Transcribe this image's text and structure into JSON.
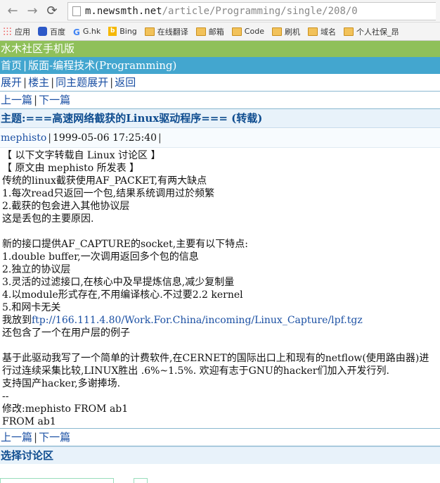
{
  "browser": {
    "url_host": "m.newsmth.net",
    "url_path": "/article/Programming/single/208/0",
    "bookmarks": [
      {
        "label": "应用",
        "icon": "apps-grid-icon"
      },
      {
        "label": "百度",
        "icon": "baidu-paw-icon"
      },
      {
        "label": "G.hk",
        "icon": "google-icon"
      },
      {
        "label": "Bing",
        "icon": "bing-icon"
      },
      {
        "label": "在线翻译",
        "icon": "folder-icon"
      },
      {
        "label": "邮箱",
        "icon": "folder-icon"
      },
      {
        "label": "Code",
        "icon": "folder-icon"
      },
      {
        "label": "刷机",
        "icon": "folder-icon"
      },
      {
        "label": "域名",
        "icon": "folder-icon"
      },
      {
        "label": "个人社保_昂",
        "icon": "folder-icon"
      }
    ]
  },
  "site": {
    "title": "水木社区手机版",
    "breadcrumb_home": "首页",
    "breadcrumb_board": "版面-编程技术(Programming)"
  },
  "actions": {
    "expand": "展开",
    "floor_owner": "楼主",
    "same_topic_expand": "同主题展开",
    "back": "返回"
  },
  "pager": {
    "prev": "上一篇",
    "next": "下一篇"
  },
  "topic": {
    "title": "主题:===高速网络截获的Linux驱动程序=== (转载)"
  },
  "post": {
    "author": "mephisto",
    "timestamp": "1999-05-06 17:25:40",
    "body_before_link": "【 以下文字转载自 Linux 讨论区 】\n【 原文由 mephisto 所发表 】\n传统的linux截获使用AF_PACKET,有两大缺点\n1.每次read只返回一个包,结果系统调用过於频繁\n2.截获的包会进入其他协议层\n这是丢包的主要原因.\n\n新的接口提供AF_CAPTURE的socket,主要有以下特点:\n1.double buffer,一次调用返回多个包的信息\n2.独立的协议层\n3.灵活的过滤接口,在核心中及早提炼信息,减少复制量\n4.以module形式存在,不用编译核心.不过要2.2 kernel\n5.和网卡无关\n我放到",
    "link": "ftp://166.111.4.80/Work.For.China/incoming/Linux_Capture/lpf.tgz",
    "body_after_link": "\n还包含了一个在用户层的例子\n\n基于此驱动我写了一个简单的计费软件,在CERNET的国际出口上和现有的netflow(使用路由器)进行过连续采集比较,LINUX胜出 .6%~1.5%. 欢迎有志于GNU的hacker们加入开发行列.\n支持国产hacker,多谢捧场.\n--\n修改:mephisto FROM ab1\nFROM ab1"
  },
  "footer": {
    "select_board": "选择讨论区"
  }
}
